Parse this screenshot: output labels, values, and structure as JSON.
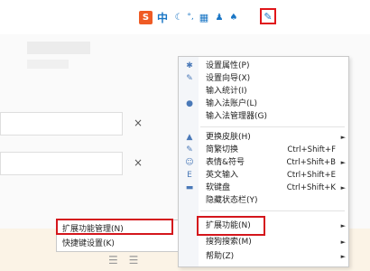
{
  "ime_toolbar": {
    "logo": "S",
    "mode": "中",
    "icons": [
      "moon-icon",
      "punctuation-icon",
      "keyboard-icon",
      "user-icon",
      "skin-icon",
      "wrench-icon"
    ]
  },
  "background": {
    "clear_symbol": "×",
    "toolbar_lines": "☰ ☰"
  },
  "menu": {
    "items": [
      {
        "label": "设置属性(P)",
        "icon": "gear-icon",
        "glyph": "✱"
      },
      {
        "label": "设置向导(X)",
        "icon": "wand-icon",
        "glyph": "✎"
      },
      {
        "label": "输入统计(I)",
        "icon": "",
        "glyph": ""
      },
      {
        "label": "输入法账户(L)",
        "icon": "account-icon",
        "glyph": "●"
      },
      {
        "label": "输入法管理器(G)",
        "icon": "",
        "glyph": ""
      },
      {
        "label": "更换皮肤(H)",
        "icon": "skin-icon",
        "glyph": "▲",
        "submenu": true
      },
      {
        "label": "简繁切换",
        "icon": "convert-icon",
        "glyph": "✎",
        "shortcut": "Ctrl+Shift+F"
      },
      {
        "label": "表情&符号",
        "icon": "emoji-icon",
        "glyph": "☺",
        "shortcut": "Ctrl+Shift+B",
        "submenu": true
      },
      {
        "label": "英文输入",
        "icon": "english-icon",
        "glyph": "E",
        "shortcut": "Ctrl+Shift+E"
      },
      {
        "label": "软键盘",
        "icon": "keyboard-icon",
        "glyph": "▬",
        "shortcut": "Ctrl+Shift+K",
        "submenu": true
      },
      {
        "label": "隐藏状态栏(Y)",
        "icon": "",
        "glyph": ""
      },
      {
        "label": "扩展功能(N)",
        "icon": "",
        "glyph": "",
        "submenu": true
      },
      {
        "label": "搜狗搜索(M)",
        "icon": "",
        "glyph": "",
        "submenu": true
      },
      {
        "label": "帮助(Z)",
        "icon": "",
        "glyph": "",
        "submenu": true
      }
    ],
    "submenu_arrow": "►"
  },
  "submenu": {
    "items": [
      {
        "label": "扩展功能管理(N)"
      },
      {
        "label": "快捷键设置(K)"
      }
    ]
  },
  "colors": {
    "highlight_border": "#d4161c",
    "icon_blue": "#1a76c5",
    "sogou_orange": "#ef5b25"
  }
}
